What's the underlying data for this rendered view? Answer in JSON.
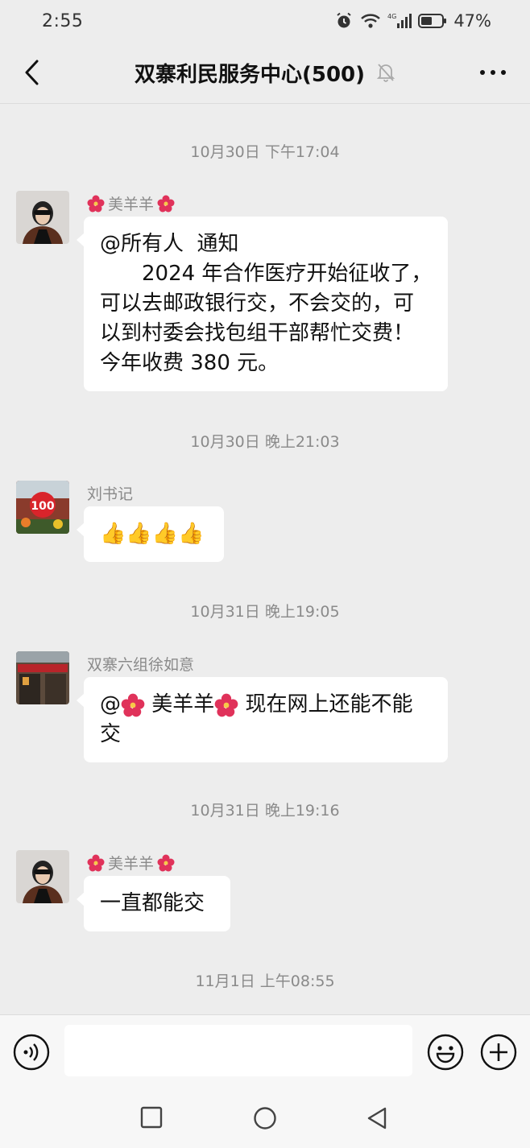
{
  "status_bar": {
    "time": "2:55",
    "battery": "47%"
  },
  "header": {
    "title": "双寨利民服务中心(500)"
  },
  "timestamps": [
    "10月30日 下午17:04",
    "10月30日 晚上21:03",
    "10月31日 晚上19:05",
    "10月31日 晚上19:16",
    "11月1日 上午08:55"
  ],
  "messages": [
    {
      "sender": "美羊羊",
      "text": "@所有人  通知",
      "lines": [
        "　　2024 年合作医疗开始征收了，",
        "可以去邮政银行交，不会交的，可",
        "以到村委会找包组干部帮忙交费！",
        "今年收费 380 元。"
      ]
    },
    {
      "sender": "刘书记",
      "text": "👍👍👍👍"
    },
    {
      "sender": "双寨六组徐如意",
      "mention_prefix": "@",
      "mention_name": " 美羊羊",
      "text_after": " 现在网上还能不能",
      "text_line2": "交"
    },
    {
      "sender": "美羊羊",
      "text": "一直都能交"
    }
  ],
  "icons": {
    "status": [
      "alarm-icon",
      "wifi-icon",
      "signal-icon",
      "battery-icon"
    ],
    "header": [
      "back-arrow-icon",
      "mute-bell-icon",
      "more-icon"
    ],
    "input": [
      "voice-icon",
      "emoji-icon",
      "plus-icon"
    ],
    "system_nav": [
      "recent-apps-icon",
      "home-icon",
      "back-icon"
    ]
  },
  "colors": {
    "background": "#ededed",
    "bubble": "#ffffff",
    "meta_text": "#8a8a8a"
  }
}
